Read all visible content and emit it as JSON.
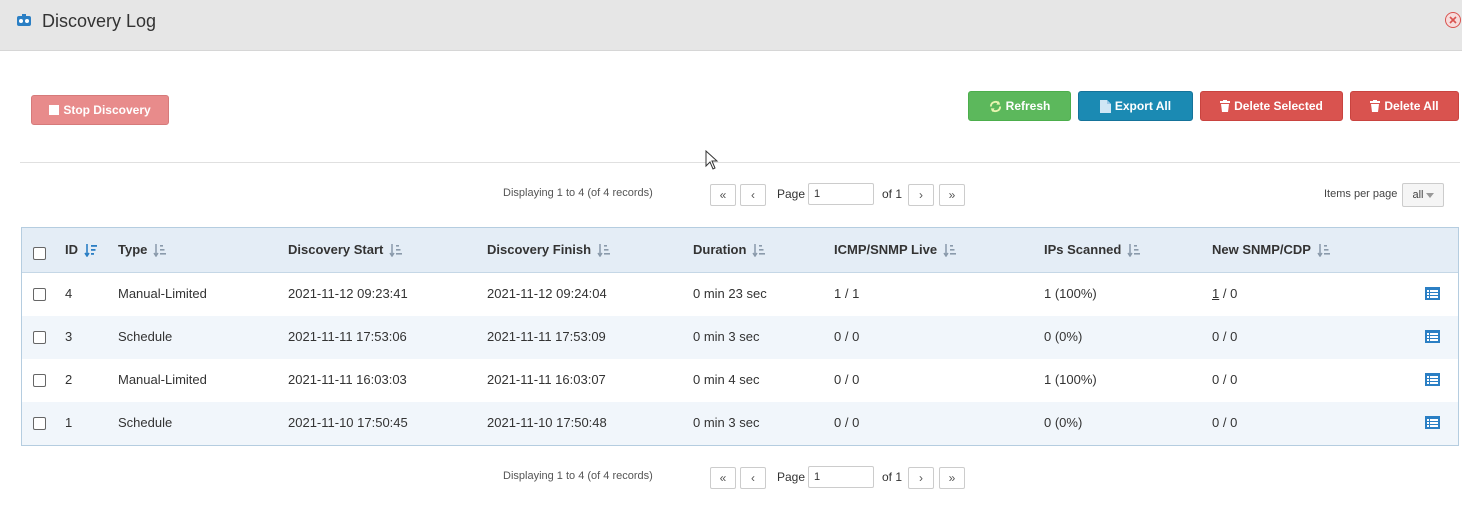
{
  "window": {
    "title": "Discovery Log",
    "app_icon": "app-icon",
    "close_icon": "close-icon"
  },
  "toolbar": {
    "stop_label": "Stop Discovery",
    "refresh_label": "Refresh",
    "export_label": "Export All",
    "delete_selected_label": "Delete Selected",
    "delete_all_label": "Delete All"
  },
  "pager_top": {
    "info": "Displaying 1 to 4 (of 4 records)",
    "first": "«",
    "prev": "‹",
    "page_label": "Page",
    "page_value": "1",
    "of_label": "of 1",
    "next": "›",
    "last": "»"
  },
  "pager_bottom": {
    "info": "Displaying 1 to 4 (of 4 records)",
    "first": "«",
    "prev": "‹",
    "page_label": "Page",
    "page_value": "1",
    "of_label": "of 1",
    "next": "›",
    "last": "»"
  },
  "items_per_page": {
    "label": "Items per page",
    "value": "all"
  },
  "table": {
    "columns": [
      "ID",
      "Type",
      "Discovery Start",
      "Discovery Finish",
      "Duration",
      "ICMP/SNMP Live",
      "IPs Scanned",
      "New SNMP/CDP"
    ],
    "rows": [
      {
        "id": "4",
        "type": "Manual-Limited",
        "start": "2021-11-12 09:23:41",
        "finish": "2021-11-12 09:24:04",
        "duration": "0 min 23 sec",
        "live": "1 / 1",
        "scanned": "1 (100%)",
        "new_a": "1",
        "new_sep": "/",
        "new_b": "0"
      },
      {
        "id": "3",
        "type": "Schedule",
        "start": "2021-11-11 17:53:06",
        "finish": "2021-11-11 17:53:09",
        "duration": "0 min 3 sec",
        "live": "0 / 0",
        "scanned": "0 (0%)",
        "new_a": "0",
        "new_sep": "/",
        "new_b": "0"
      },
      {
        "id": "2",
        "type": "Manual-Limited",
        "start": "2021-11-11 16:03:03",
        "finish": "2021-11-11 16:03:07",
        "duration": "0 min 4 sec",
        "live": "0 / 0",
        "scanned": "1 (100%)",
        "new_a": "0",
        "new_sep": "/",
        "new_b": "0"
      },
      {
        "id": "1",
        "type": "Schedule",
        "start": "2021-11-10 17:50:45",
        "finish": "2021-11-10 17:50:48",
        "duration": "0 min 3 sec",
        "live": "0 / 0",
        "scanned": "0 (0%)",
        "new_a": "0",
        "new_sep": "/",
        "new_b": "0"
      }
    ]
  },
  "colors": {
    "refresh": "#5cb85c",
    "export": "#1b8ab3",
    "delete": "#d9534f",
    "stop": "#e88b8b",
    "header_bg": "#e4edf6",
    "alt_row": "#f1f6fb"
  }
}
